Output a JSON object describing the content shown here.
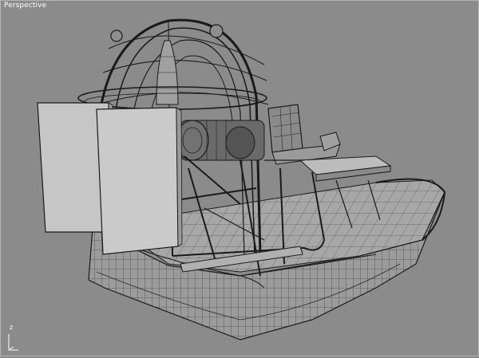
{
  "viewport": {
    "label": "Perspective",
    "background_color": "#8b8b8b",
    "wire_color": "#1e1e1e",
    "panel_color": "#c4c4c4",
    "hull_color": "#9d9d9d"
  },
  "gizmo": {
    "z_label": "z",
    "icon": "axis-tripod-icon"
  }
}
